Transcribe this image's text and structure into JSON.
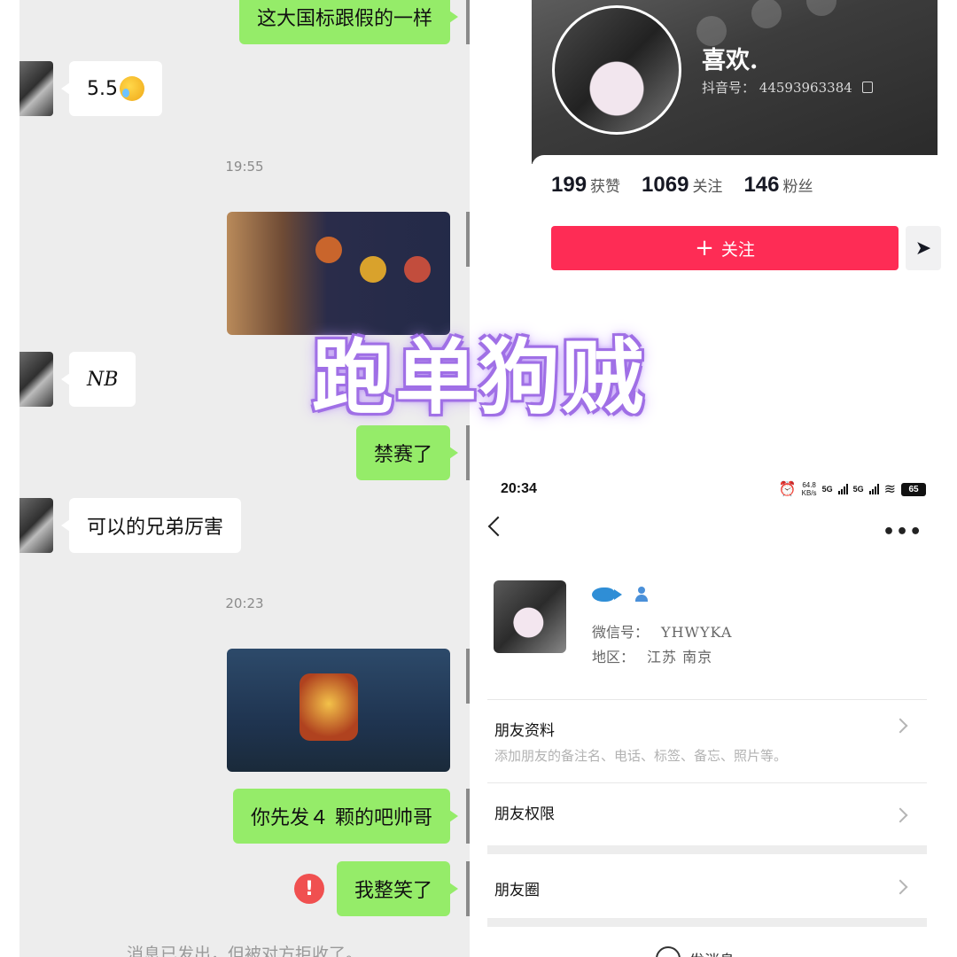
{
  "chat": {
    "messages": {
      "m1": "这大国标跟假的一样",
      "m2": "5.5",
      "t1": "19:55",
      "m3": "NB",
      "m4": "禁赛了",
      "m5": "可以的兄弟厉害",
      "t2": "20:23",
      "m6": "你先发４ 颗的吧帅哥",
      "m7": "我整笑了"
    },
    "error_mark": "!",
    "footer_note": "消息已发出，但被对方拒收了。"
  },
  "douyin": {
    "name": "喜欢.",
    "id_label": "抖音号：",
    "id_value": "44593963384",
    "stats": [
      {
        "num": "199",
        "label": "获赞"
      },
      {
        "num": "1069",
        "label": "关注"
      },
      {
        "num": "146",
        "label": "粉丝"
      }
    ],
    "follow_label": "关注",
    "follow_plus": "+",
    "send_glyph": "➤"
  },
  "watermark": "跑单狗贼",
  "wechat": {
    "status": {
      "time": "20:34",
      "speed_top": "64.8",
      "speed_bottom": "KB/s",
      "net1": "5G",
      "net2": "5G",
      "battery": "65"
    },
    "more": "•••",
    "wechat_id_label": "微信号：",
    "wechat_id": "YHWYKA",
    "region_label": "地区：",
    "region": "江苏  南京",
    "friend_profile_title": "朋友资料",
    "friend_profile_sub": "添加朋友的备注名、电话、标签、备忘、照片等。",
    "friend_permissions": "朋友权限",
    "moments": "朋友圈",
    "send_message": "发消息"
  },
  "colors": {
    "outgoing_bubble": "#95ec69",
    "chat_bg": "#ededed",
    "douyin_follow": "#fe2c55",
    "watermark_stroke": "#a070e6",
    "error": "#f05050"
  }
}
